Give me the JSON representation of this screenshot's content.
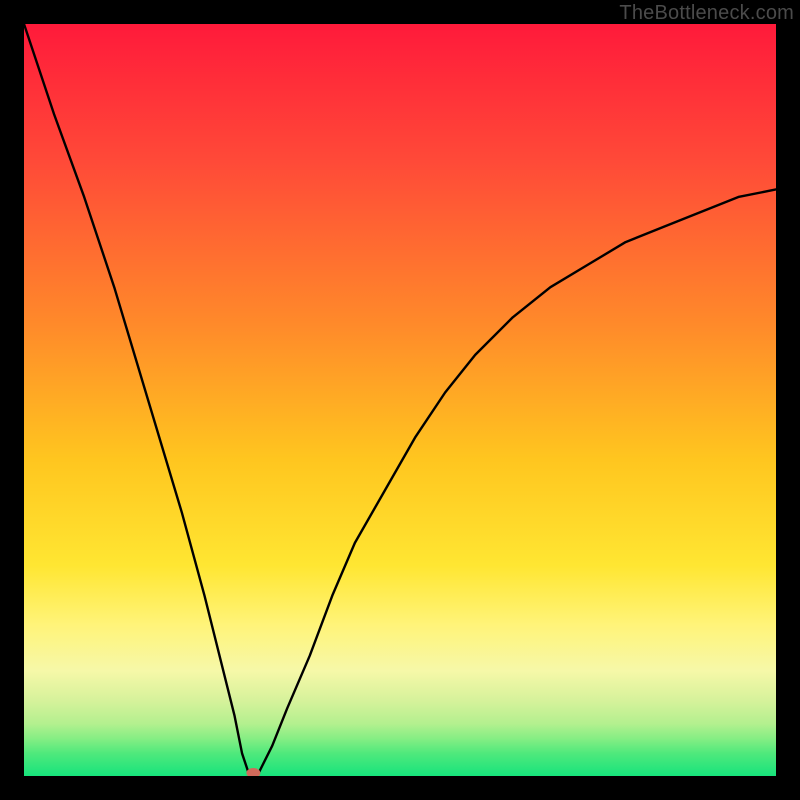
{
  "watermark": {
    "text": "TheBottleneck.com"
  },
  "chart_data": {
    "type": "line",
    "title": "",
    "xlabel": "",
    "ylabel": "",
    "xlim": [
      0,
      100
    ],
    "ylim": [
      0,
      100
    ],
    "grid": false,
    "legend": false,
    "background_gradient_stops": [
      {
        "y": 0,
        "color": "#ff1a3a"
      },
      {
        "y": 18,
        "color": "#ff4938"
      },
      {
        "y": 40,
        "color": "#ff8a2a"
      },
      {
        "y": 58,
        "color": "#ffc61f"
      },
      {
        "y": 72,
        "color": "#ffe632"
      },
      {
        "y": 80,
        "color": "#fff47a"
      },
      {
        "y": 86,
        "color": "#f6f8a8"
      },
      {
        "y": 90,
        "color": "#d6f29b"
      },
      {
        "y": 93,
        "color": "#b4f08f"
      },
      {
        "y": 95,
        "color": "#86ee84"
      },
      {
        "y": 97,
        "color": "#4fe97c"
      },
      {
        "y": 100,
        "color": "#17e37c"
      }
    ],
    "series": [
      {
        "name": "bottleneck-curve",
        "color": "#000000",
        "x": [
          0,
          4,
          8,
          12,
          15,
          18,
          21,
          24,
          26,
          28,
          29,
          30,
          31,
          33,
          35,
          38,
          41,
          44,
          48,
          52,
          56,
          60,
          65,
          70,
          75,
          80,
          85,
          90,
          95,
          100
        ],
        "y": [
          100,
          88,
          77,
          65,
          55,
          45,
          35,
          24,
          16,
          8,
          3,
          0,
          0,
          4,
          9,
          16,
          24,
          31,
          38,
          45,
          51,
          56,
          61,
          65,
          68,
          71,
          73,
          75,
          77,
          78
        ]
      }
    ],
    "marker": {
      "name": "optimum-point",
      "x": 30.5,
      "y": 0,
      "color": "#d06a5b",
      "rx": 7,
      "ry": 5
    }
  }
}
